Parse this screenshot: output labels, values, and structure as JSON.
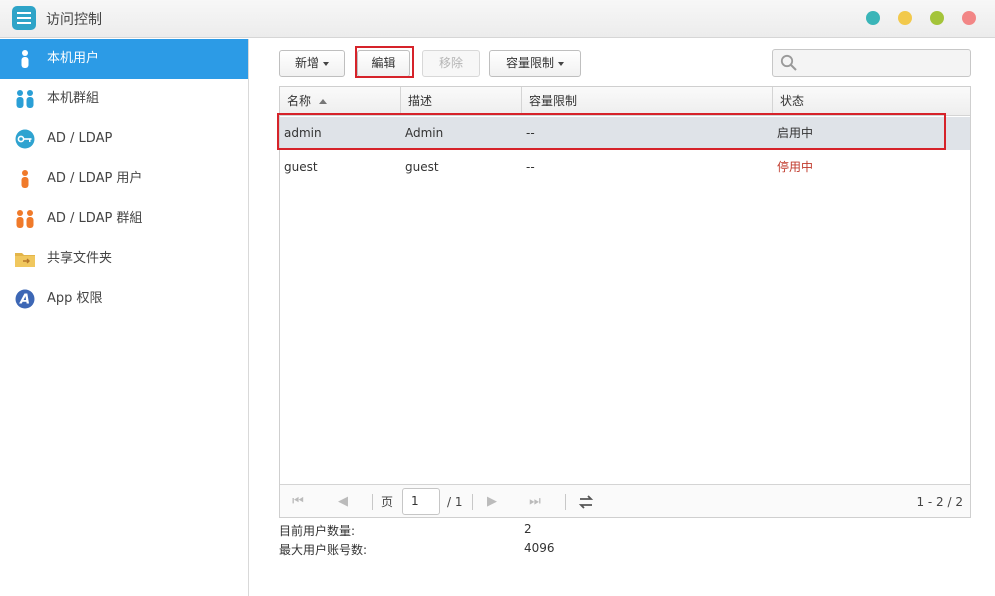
{
  "window": {
    "title": "访问控制",
    "controls": [
      {
        "name": "teal-window-button",
        "color": "#3ab5b8"
      },
      {
        "name": "yellow-window-button",
        "color": "#f2c94c"
      },
      {
        "name": "green-window-button",
        "color": "#a4c43a"
      },
      {
        "name": "red-window-button",
        "color": "#f28686"
      }
    ]
  },
  "sidebar": {
    "items": [
      {
        "label": "本机用户",
        "icon": "user-icon",
        "active": true
      },
      {
        "label": "本机群組",
        "icon": "group-icon",
        "active": false
      },
      {
        "label": "AD / LDAP",
        "icon": "key-icon",
        "active": false
      },
      {
        "label": "AD / LDAP 用户",
        "icon": "user-icon",
        "active": false
      },
      {
        "label": "AD / LDAP 群組",
        "icon": "group-icon",
        "active": false
      },
      {
        "label": "共享文件夹",
        "icon": "folder-icon",
        "active": false
      },
      {
        "label": "App 权限",
        "icon": "app-icon",
        "active": false
      }
    ]
  },
  "toolbar": {
    "add_label": "新增",
    "edit_label": "編辑",
    "remove_label": "移除",
    "quota_label": "容量限制",
    "search_placeholder": ""
  },
  "table": {
    "columns": [
      "名称",
      "描述",
      "容量限制",
      "状态"
    ],
    "rows": [
      {
        "name": "admin",
        "description": "Admin",
        "quota": "--",
        "status": "启用中",
        "selected": true
      },
      {
        "name": "guest",
        "description": "guest",
        "quota": "--",
        "status": "停用中",
        "selected": false
      }
    ]
  },
  "pager": {
    "page_label": "页",
    "current_page": "1",
    "total_pages": "/ 1",
    "range": "1 - 2 / 2"
  },
  "stats": {
    "current_users_label": "目前用户数量:",
    "current_users_value": "2",
    "max_users_label": "最大用户账号数:",
    "max_users_value": "4096"
  },
  "colors": {
    "accent": "#2c9be6",
    "highlight": "#d6232a",
    "disabled_status": "#c0392b"
  }
}
